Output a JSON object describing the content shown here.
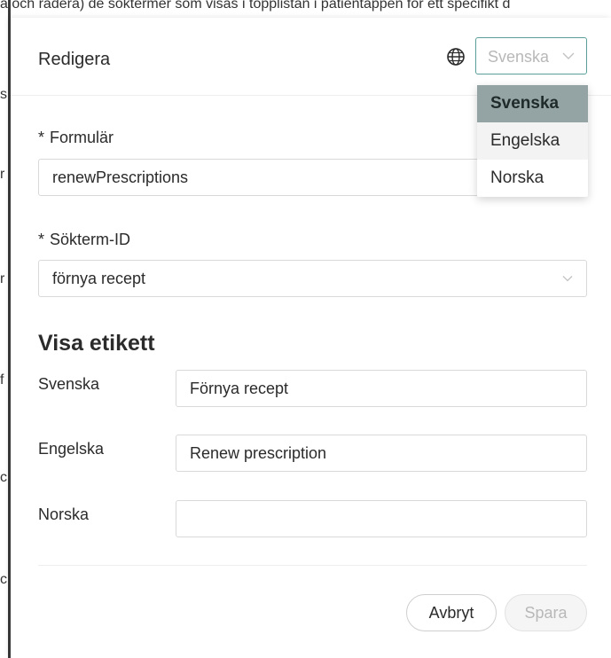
{
  "background": {
    "top_text": "a och radera) de söktermer som visas i topplistan i patientappen för ett specifikt d"
  },
  "modal": {
    "title": "Redigera",
    "language_select": {
      "value": "Svenska",
      "options": [
        "Svenska",
        "Engelska",
        "Norska"
      ],
      "selected_index": 0,
      "hover_index": 1
    },
    "form_field": {
      "label": "Formulär",
      "required_mark": "*",
      "value": "renewPrescriptions"
    },
    "search_term_field": {
      "label": "Sökterm-ID",
      "required_mark": "*",
      "value": "förnya recept"
    },
    "display_label_section": {
      "heading": "Visa etikett",
      "rows": [
        {
          "label": "Svenska",
          "value": "Förnya recept"
        },
        {
          "label": "Engelska",
          "value": "Renew prescription"
        },
        {
          "label": "Norska",
          "value": ""
        }
      ]
    },
    "buttons": {
      "cancel": "Avbryt",
      "save": "Spara"
    }
  },
  "colors": {
    "accent_border": "#5a9e9a",
    "selected_option_bg": "#94a3a3",
    "disabled_text": "#b8b8b8"
  }
}
